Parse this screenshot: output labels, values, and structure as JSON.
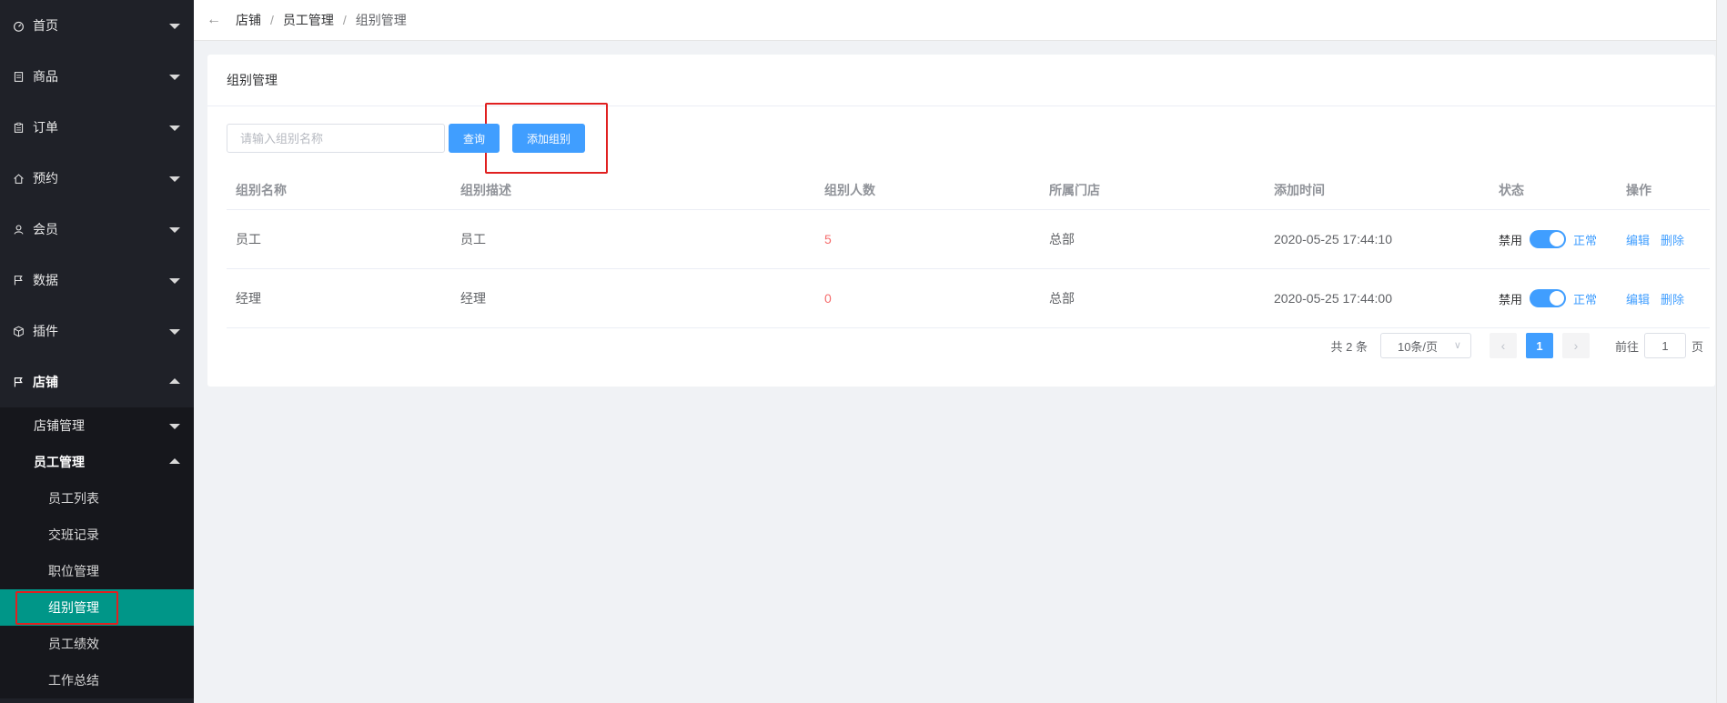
{
  "sidebar": {
    "menus": [
      {
        "label": "首页",
        "icon": "dashboard-icon"
      },
      {
        "label": "商品",
        "icon": "document-icon"
      },
      {
        "label": "订单",
        "icon": "clipboard-icon"
      },
      {
        "label": "预约",
        "icon": "home-icon"
      },
      {
        "label": "会员",
        "icon": "user-icon"
      },
      {
        "label": "数据",
        "icon": "flag-icon"
      },
      {
        "label": "插件",
        "icon": "cube-icon"
      },
      {
        "label": "店铺",
        "icon": "flag-icon"
      }
    ],
    "sub": [
      {
        "label": "店铺管理"
      },
      {
        "label": "员工管理"
      }
    ],
    "leaves": [
      {
        "label": "员工列表"
      },
      {
        "label": "交班记录"
      },
      {
        "label": "职位管理"
      },
      {
        "label": "组别管理"
      },
      {
        "label": "员工绩效"
      },
      {
        "label": "工作总结"
      }
    ]
  },
  "breadcrumb": [
    "店铺",
    "员工管理",
    "组别管理"
  ],
  "card": {
    "title": "组别管理",
    "search_placeholder": "请输入组别名称",
    "query_label": "查询",
    "add_label": "添加组别"
  },
  "table": {
    "headers": [
      "组别名称",
      "组别描述",
      "组别人数",
      "所属门店",
      "添加时间",
      "状态",
      "操作"
    ],
    "rows": [
      {
        "name": "员工",
        "desc": "员工",
        "count": "5",
        "store": "总部",
        "time": "2020-05-25 17:44:10",
        "off": "禁用",
        "on": "正常",
        "edit": "编辑",
        "del": "删除"
      },
      {
        "name": "经理",
        "desc": "经理",
        "count": "0",
        "store": "总部",
        "time": "2020-05-25 17:44:00",
        "off": "禁用",
        "on": "正常",
        "edit": "编辑",
        "del": "删除"
      }
    ]
  },
  "pagination": {
    "total": "共 2 条",
    "page_size": "10条/页",
    "current": "1",
    "goto_prefix": "前往",
    "goto_value": "1",
    "goto_suffix": "页"
  },
  "colors": {
    "primary": "#409eff",
    "active_menu": "#009688",
    "highlight": "#e02020",
    "sidebar": "#1f2128"
  }
}
